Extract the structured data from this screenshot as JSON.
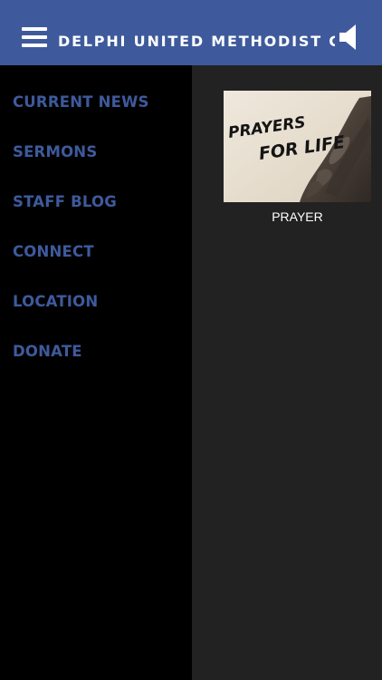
{
  "header": {
    "title": "DELPHI UNITED METHODIST CHURCH",
    "menu_icon": "hamburger-menu-icon",
    "audio_icon": "speaker-icon"
  },
  "sidebar": {
    "items": [
      {
        "label": "CURRENT NEWS"
      },
      {
        "label": "SERMONS"
      },
      {
        "label": "STAFF BLOG"
      },
      {
        "label": "CONNECT"
      },
      {
        "label": "LOCATION"
      },
      {
        "label": "DONATE"
      }
    ]
  },
  "main": {
    "tiles": [
      {
        "caption": "PRAYER",
        "image_text_line1": "PRAYERS",
        "image_text_line2": "FOR LIFE"
      }
    ]
  },
  "colors": {
    "header_bg": "#3e5a9c",
    "menu_text": "#3e5a9c",
    "sidebar_bg": "#000000",
    "content_bg": "#222222"
  }
}
